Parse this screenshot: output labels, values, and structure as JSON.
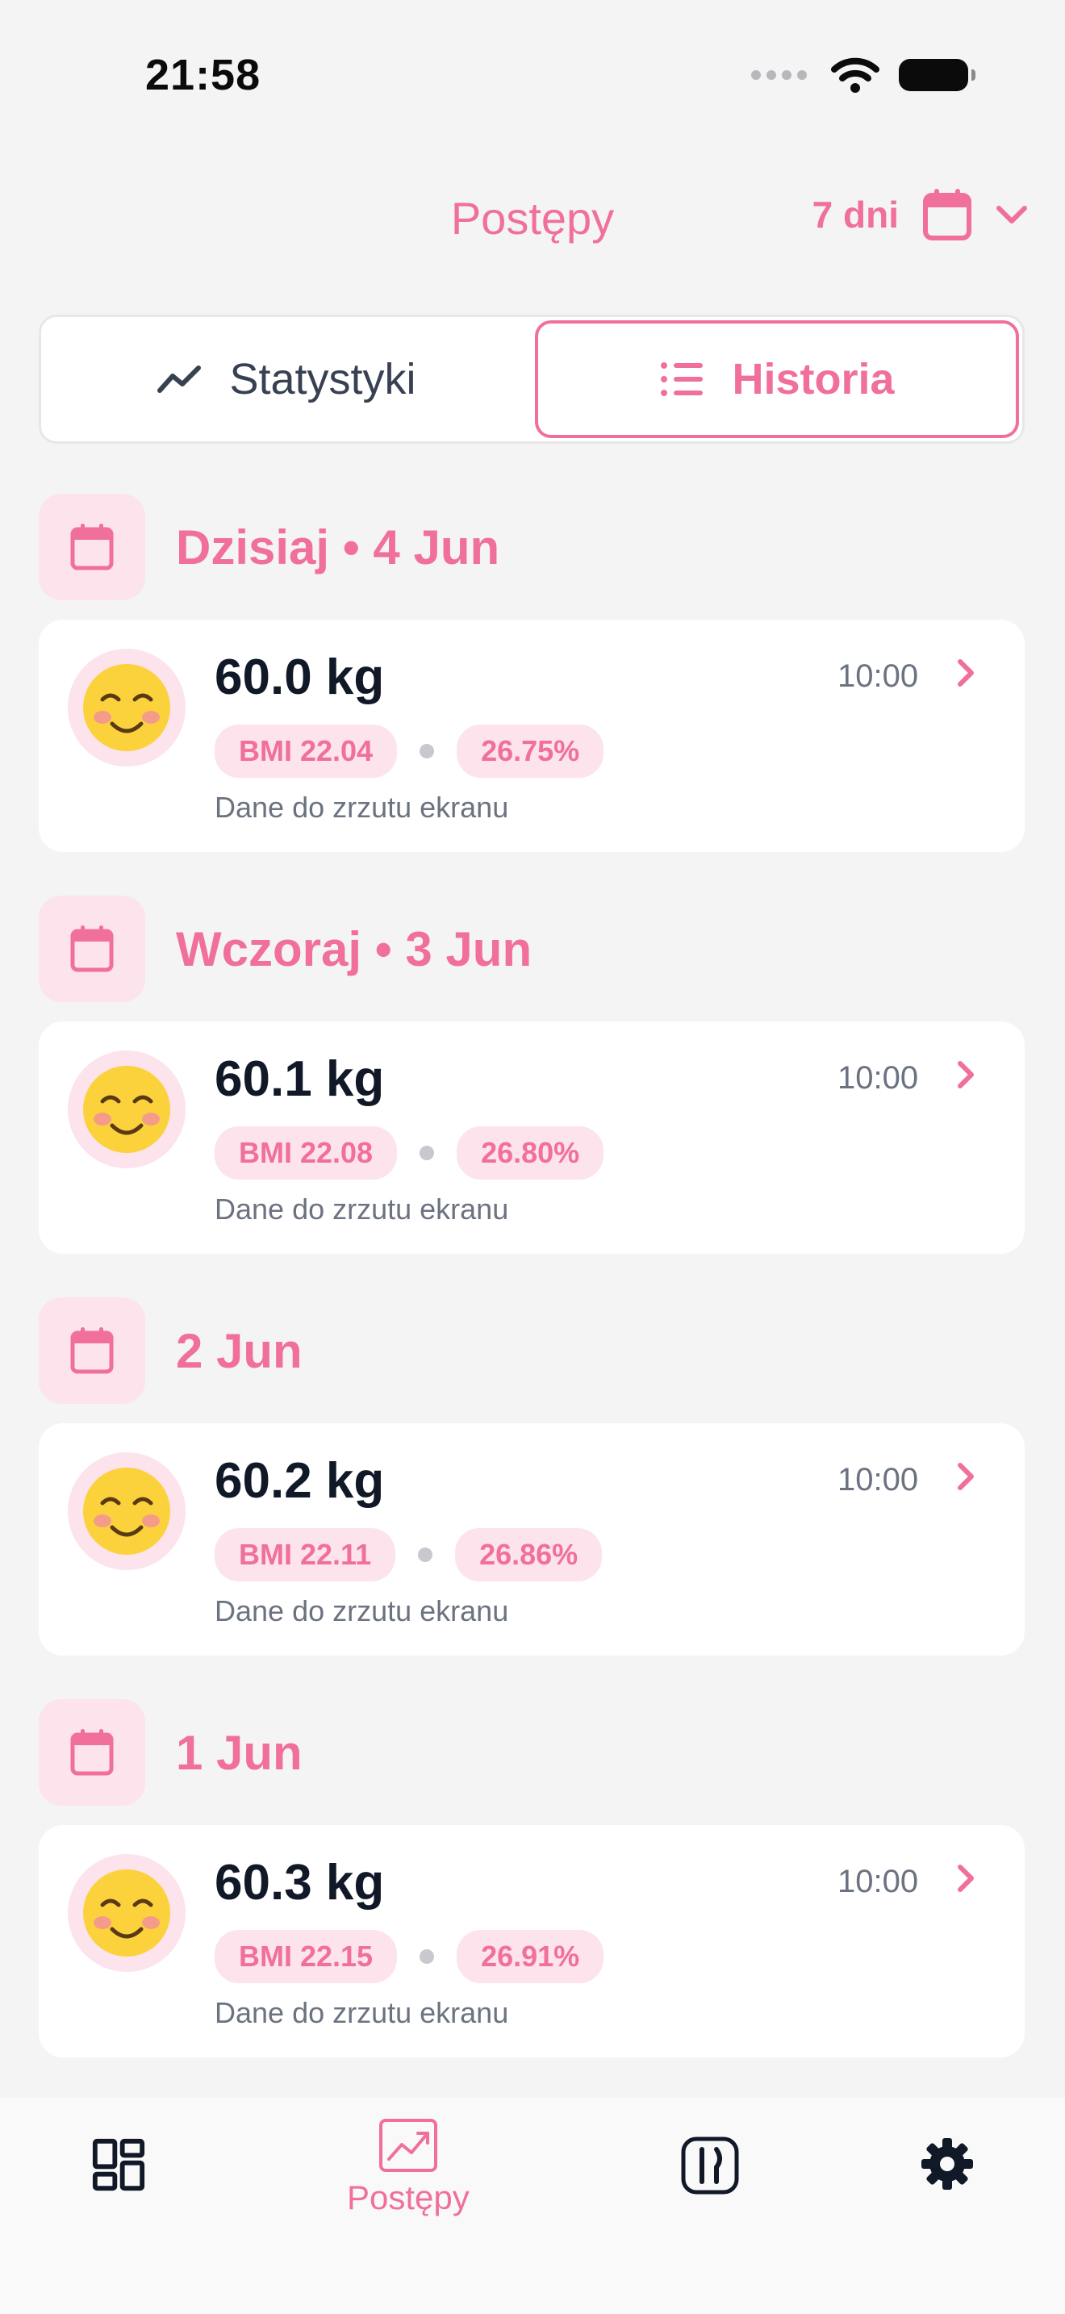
{
  "status_bar": {
    "time": "21:58",
    "icons": [
      "signal-icon",
      "wifi-icon",
      "battery-icon"
    ]
  },
  "header": {
    "title": "Postępy",
    "range_label": "7 dni",
    "icons": [
      "calendar-icon",
      "chevron-down-icon"
    ]
  },
  "segmented": {
    "stats_label": "Statystyki",
    "history_label": "Historia",
    "selected": "Historia"
  },
  "days": [
    {
      "title": "Dzisiaj • 4 Jun",
      "entries": [
        {
          "weight": "60.0 kg",
          "time": "10:00",
          "bmi": "BMI 22.04",
          "fat": "26.75%",
          "note": "Dane do zrzutu ekranu"
        }
      ]
    },
    {
      "title": "Wczoraj • 3 Jun",
      "entries": [
        {
          "weight": "60.1 kg",
          "time": "10:00",
          "bmi": "BMI 22.08",
          "fat": "26.80%",
          "note": "Dane do zrzutu ekranu"
        }
      ]
    },
    {
      "title": "2 Jun",
      "entries": [
        {
          "weight": "60.2 kg",
          "time": "10:00",
          "bmi": "BMI 22.11",
          "fat": "26.86%",
          "note": "Dane do zrzutu ekranu"
        }
      ]
    },
    {
      "title": "1 Jun",
      "entries": [
        {
          "weight": "60.3 kg",
          "time": "10:00",
          "bmi": "BMI 22.15",
          "fat": "26.91%",
          "note": "Dane do zrzutu ekranu"
        }
      ]
    }
  ],
  "tab_bar": {
    "active": "Postępy",
    "items": [
      {
        "icon": "dashboard-icon",
        "label": ""
      },
      {
        "icon": "progress-chart-icon",
        "label": "Postępy"
      },
      {
        "icon": "meals-icon",
        "label": ""
      },
      {
        "icon": "settings-gear-icon",
        "label": ""
      }
    ]
  },
  "colors": {
    "accent": "#f0709b",
    "accent_soft": "#fce3ec",
    "background": "#f4f4f5",
    "text": "#111827",
    "muted": "#6b7280"
  }
}
